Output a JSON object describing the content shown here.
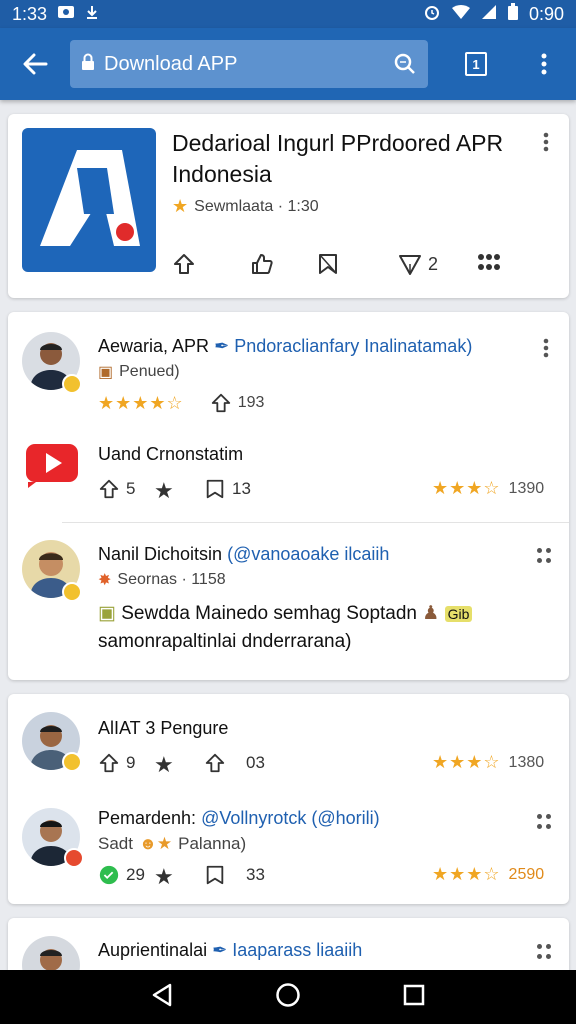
{
  "status_bar": {
    "time": "1:33",
    "clock": "0:90"
  },
  "app_bar": {
    "search_query": "Download APP"
  },
  "app_card": {
    "title": "Dedarioal Ingurl PPrdoored APR Indonesia",
    "subtitle": "Sewmlaata · 1:30",
    "actions": {
      "share_count": "2"
    }
  },
  "card1": {
    "post1": {
      "name": "Aewaria, APR",
      "link": "Pndoraclianfary Inalinatamak)",
      "tag": "Penued)",
      "stars": "★★★★☆",
      "count": "193"
    },
    "post2": {
      "name": "Uand Crnonstatim",
      "likes": "5",
      "comments": "13",
      "stars": "★★★☆",
      "rating": "1390"
    },
    "post3": {
      "name": "Nanil Dichoitsin",
      "link": "(@vanoaoake ilcaiih",
      "meta": "Seornas · 1158",
      "body": "Sewdda Mainedo semhag Soptadn",
      "body_line2": "samonrapaltinlai dnderrarana)",
      "tag": "Gib"
    }
  },
  "card2": {
    "post1": {
      "name": "AlIAT 3 Pengure",
      "likes": "9",
      "shares": "03",
      "stars": "★★★☆",
      "rating": "1380"
    },
    "post2": {
      "name": "Pemardenh:",
      "link": "@Vollnyrotck (@horili)",
      "meta": "Sadt",
      "tag": "Palanna)",
      "likes": "29",
      "comments": "33",
      "stars": "★★★☆",
      "rating": "2590"
    }
  },
  "card3": {
    "post1": {
      "name": "Auprientinalai",
      "link": "Iaaparass liaaiih"
    }
  }
}
